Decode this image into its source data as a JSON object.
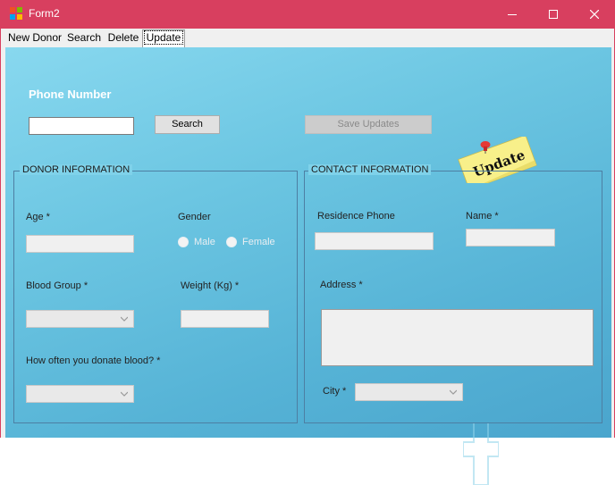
{
  "window": {
    "title": "Form2"
  },
  "tabs": [
    {
      "label": "New Donor"
    },
    {
      "label": "Search"
    },
    {
      "label": "Delete"
    },
    {
      "label": "Update"
    }
  ],
  "search_row": {
    "phone_label": "Phone Number",
    "phone_value": "",
    "search_button": "Search",
    "save_button": "Save Updates"
  },
  "sticky_note": {
    "text": "Update",
    "icon": "pushpin-icon"
  },
  "donor": {
    "title": "DONOR INFORMATION",
    "age_label": "Age *",
    "age_value": "",
    "gender_label": "Gender",
    "gender_options": [
      "Male",
      "Female"
    ],
    "blood_group_label": "Blood Group *",
    "blood_group_value": "",
    "weight_label": "Weight (Kg) *",
    "weight_value": "",
    "frequency_label": "How often you donate blood? *",
    "frequency_value": ""
  },
  "contact": {
    "title": "CONTACT INFORMATION",
    "residence_label": "Residence Phone",
    "residence_value": "",
    "name_label": "Name *",
    "name_value": "",
    "address_label": "Address *",
    "address_value": "",
    "city_label": "City *",
    "city_value": ""
  },
  "colors": {
    "titlebar": "#d83f5f",
    "panel_gradient": [
      "#88d8ef",
      "#4aa5cd"
    ],
    "sticky": "#f8f08a",
    "pin": "#e53935"
  }
}
